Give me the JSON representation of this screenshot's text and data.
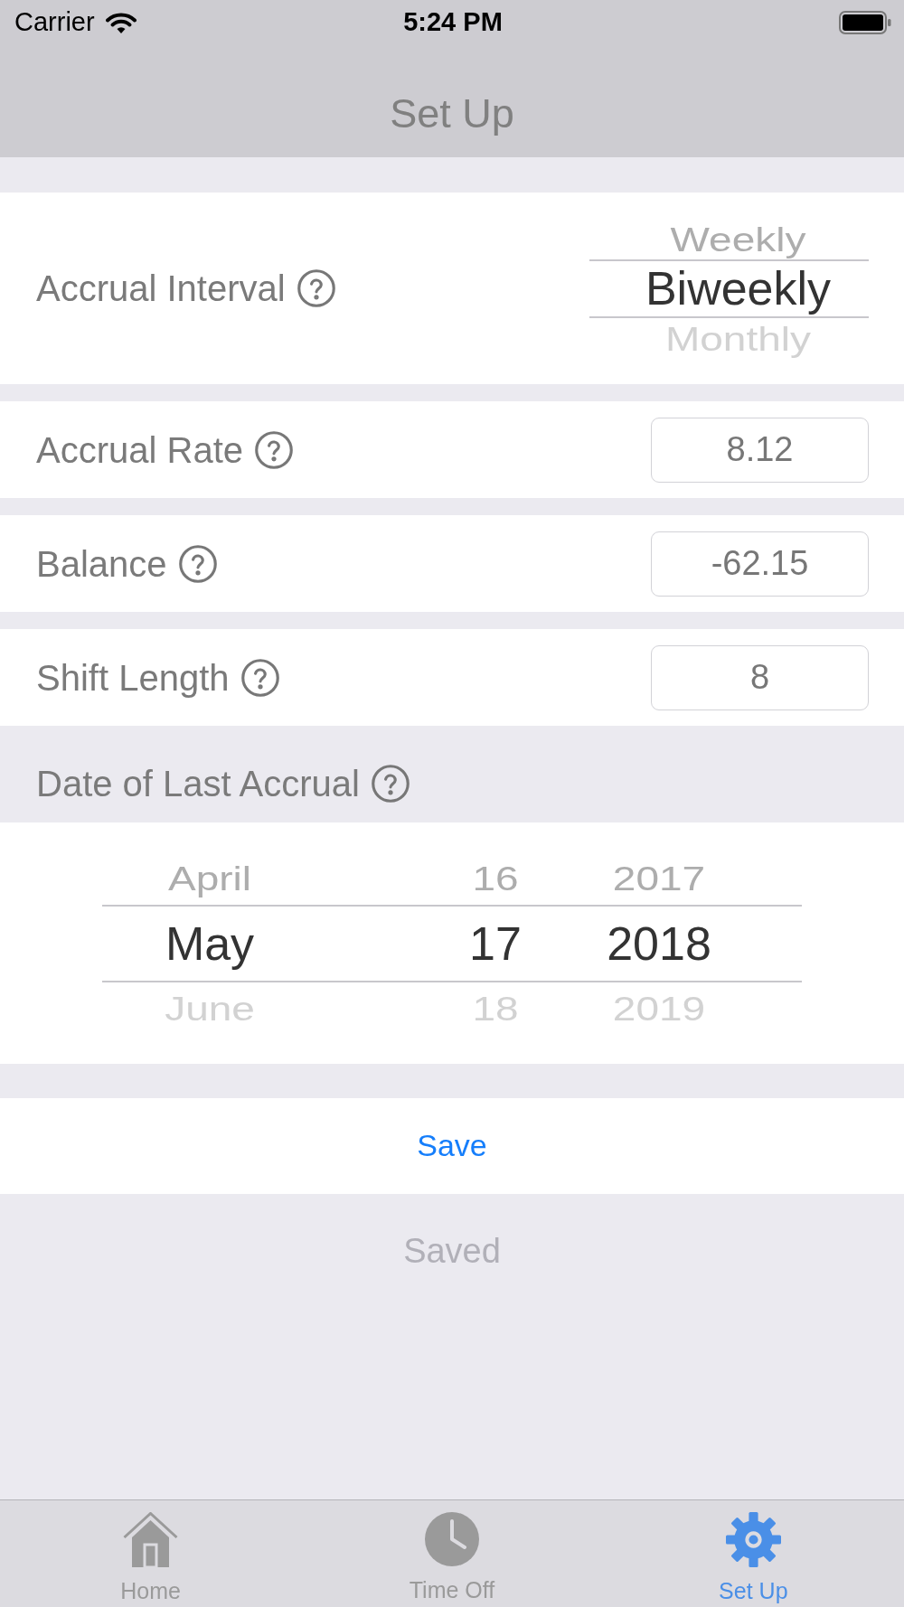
{
  "status_bar": {
    "carrier": "Carrier",
    "time": "5:24 PM"
  },
  "nav_bar": {
    "title": "Set Up"
  },
  "form": [
    {
      "kind": "picker",
      "label": "Accrual Interval",
      "options": [
        {
          "label": "Weekly",
          "selected": false
        },
        {
          "label": "Biweekly",
          "selected": true
        },
        {
          "label": "Monthly",
          "selected": false
        }
      ]
    },
    {
      "kind": "field",
      "label": "Accrual Rate",
      "value": "8.12"
    },
    {
      "kind": "field",
      "label": "Balance",
      "value": "-62.15"
    },
    {
      "kind": "field",
      "label": "Shift Length",
      "value": "8"
    }
  ],
  "date_section": {
    "label": "Date of Last Accrual",
    "columns": [
      {
        "options": [
          {
            "label": "April",
            "selected": false
          },
          {
            "label": "May",
            "selected": true
          },
          {
            "label": "June",
            "selected": false
          }
        ]
      },
      {
        "options": [
          {
            "label": "16",
            "selected": false
          },
          {
            "label": "17",
            "selected": true
          },
          {
            "label": "18",
            "selected": false
          }
        ]
      },
      {
        "options": [
          {
            "label": "2017",
            "selected": false
          },
          {
            "label": "2018",
            "selected": true
          },
          {
            "label": "2019",
            "selected": false
          }
        ]
      }
    ]
  },
  "save_button": {
    "label": "Save"
  },
  "save_status": {
    "text": "Saved"
  },
  "tab_bar": [
    {
      "kind": "home",
      "label": "Home",
      "selected": false
    },
    {
      "kind": "clock",
      "label": "Time Off",
      "selected": false
    },
    {
      "kind": "gear",
      "label": "Set Up",
      "selected": true
    }
  ]
}
